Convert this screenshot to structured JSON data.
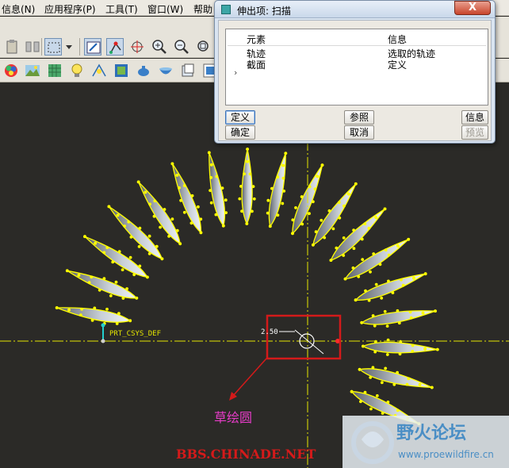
{
  "menu": {
    "items": [
      "信息(N)",
      "应用程序(P)",
      "工具(T)",
      "窗口(W)",
      "帮助"
    ]
  },
  "toolbar_row1": {
    "icons": [
      "paste-icon",
      "mirror-icon",
      "select-box-icon",
      "dropdown-arrow-icon",
      "sketch-view-icon",
      "datum-point-icon",
      "spin-center-icon",
      "zoom-in-icon",
      "zoom-out-icon",
      "zoom-fit-icon"
    ]
  },
  "toolbar_row2": {
    "icons": [
      "appearance-icon",
      "scene-icon",
      "model-tree-icon",
      "light-icon",
      "perspective-icon",
      "render-icon",
      "teapot-icon",
      "bowl-icon",
      "shading-icon",
      "repaint-icon"
    ]
  },
  "dialog": {
    "title": "伸出项: 扫描",
    "close_label": "X",
    "table": {
      "headers": [
        "元素",
        "信息"
      ],
      "rows": [
        {
          "element": "轨迹",
          "info": "选取的轨迹"
        },
        {
          "element": "截面",
          "info": "定义"
        }
      ],
      "row_marker": "›"
    },
    "buttons": {
      "define": "定义",
      "refs": "参照",
      "info": "信息",
      "ok": "确定",
      "cancel": "取消",
      "preview": "预览"
    }
  },
  "graphics": {
    "csys_label": "PRT_CSYS_DEF",
    "dimension_label": "2.50",
    "annotation": "草绘圆",
    "annotation_color": "#e73cc8",
    "highlight_color": "#d41a1a",
    "entity_color": "#ffff00"
  },
  "watermark": {
    "site": "BBS.CHINADE.NET",
    "forum_name": "野火论坛",
    "forum_url": "www.proewildfire.cn"
  }
}
